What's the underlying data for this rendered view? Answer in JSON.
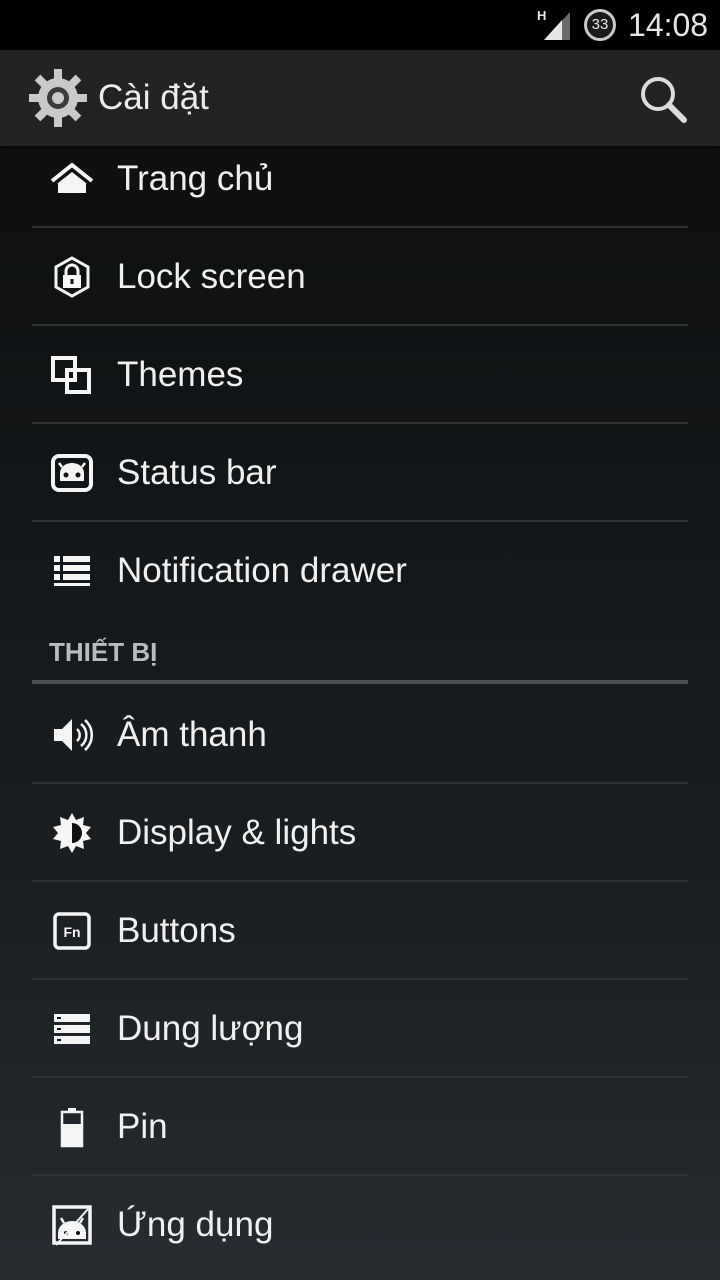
{
  "status_bar": {
    "network_type": "H",
    "notification_count": "33",
    "time": "14:08"
  },
  "action_bar": {
    "title": "Cài đặt",
    "app_icon": "gear-icon",
    "search_icon": "search-icon"
  },
  "items_top": [
    {
      "label": "Trang chủ",
      "icon": "home-icon"
    },
    {
      "label": "Lock screen",
      "icon": "lock-icon"
    },
    {
      "label": "Themes",
      "icon": "themes-icon"
    },
    {
      "label": "Status bar",
      "icon": "status-bar-icon"
    },
    {
      "label": "Notification drawer",
      "icon": "notification-drawer-icon"
    }
  ],
  "section": {
    "title": "THIẾT BỊ"
  },
  "items_device": [
    {
      "label": "Âm thanh",
      "icon": "speaker-icon"
    },
    {
      "label": "Display & lights",
      "icon": "brightness-icon"
    },
    {
      "label": "Buttons",
      "icon": "fn-button-icon"
    },
    {
      "label": "Dung lượng",
      "icon": "storage-icon"
    },
    {
      "label": "Pin",
      "icon": "battery-icon"
    },
    {
      "label": "Ứng dụng",
      "icon": "apps-icon"
    }
  ],
  "colors": {
    "status_bar_bg": "#000000",
    "action_bar_bg": "#232323",
    "text": "#f0f0f0",
    "section_header": "#b8bcbf"
  }
}
